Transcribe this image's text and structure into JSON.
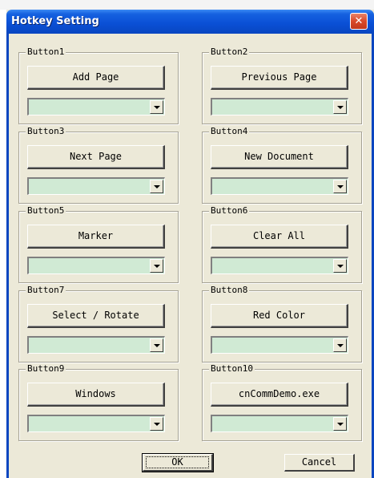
{
  "window": {
    "title": "Hotkey Setting"
  },
  "groups": [
    {
      "label": "Button1",
      "button": "Add Page",
      "combo": ""
    },
    {
      "label": "Button2",
      "button": "Previous Page",
      "combo": ""
    },
    {
      "label": "Button3",
      "button": "Next Page",
      "combo": ""
    },
    {
      "label": "Button4",
      "button": "New Document",
      "combo": ""
    },
    {
      "label": "Button5",
      "button": "Marker",
      "combo": ""
    },
    {
      "label": "Button6",
      "button": "Clear All",
      "combo": ""
    },
    {
      "label": "Button7",
      "button": "Select / Rotate",
      "combo": ""
    },
    {
      "label": "Button8",
      "button": "Red Color",
      "combo": ""
    },
    {
      "label": "Button9",
      "button": "Windows",
      "combo": ""
    },
    {
      "label": "Button10",
      "button": "cnCommDemo.exe",
      "combo": ""
    }
  ],
  "footer": {
    "ok_label": "OK",
    "cancel_label": "Cancel"
  },
  "colors": {
    "titlebar": "#0a4fd5",
    "dialog_bg": "#ece9d8",
    "combo_bg": "#d0ead4",
    "close_button": "#d9492a"
  },
  "icons": {
    "close": "close-icon",
    "dropdown": "chevron-down-icon"
  }
}
